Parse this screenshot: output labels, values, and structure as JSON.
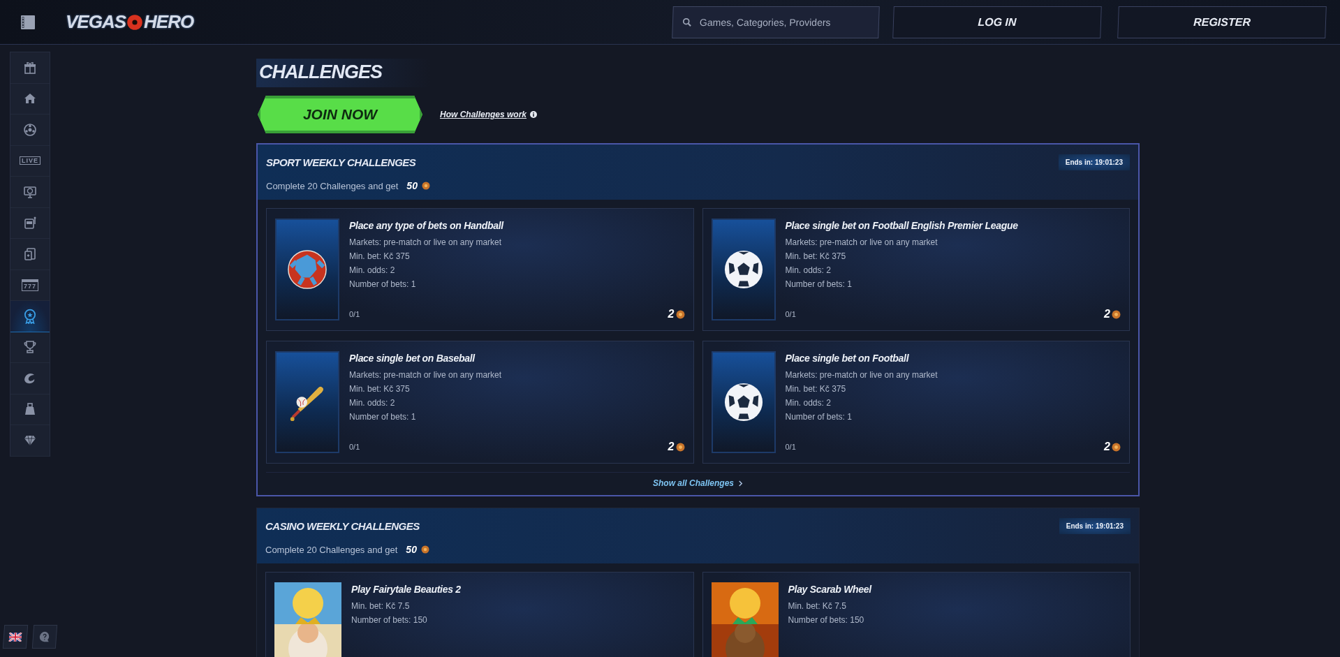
{
  "header": {
    "logo": {
      "left": "VEGAS",
      "right": "HERO"
    },
    "search": {
      "placeholder": "Games, Categories, Providers"
    },
    "buttons": [
      "LOG IN",
      "REGISTER"
    ]
  },
  "sidebar": {
    "items": [
      {
        "kind": "gift",
        "selected": false
      },
      {
        "kind": "home",
        "selected": false
      },
      {
        "kind": "ball",
        "selected": false
      },
      {
        "kind": "live",
        "label": "LIVE",
        "selected": false
      },
      {
        "kind": "screen",
        "selected": false
      },
      {
        "kind": "slot",
        "selected": false
      },
      {
        "kind": "cards",
        "selected": false
      },
      {
        "kind": "jackpot",
        "label": "777",
        "selected": false
      },
      {
        "kind": "medal",
        "selected": true
      },
      {
        "kind": "trophy",
        "selected": false
      },
      {
        "kind": "c",
        "selected": false
      },
      {
        "kind": "bag",
        "selected": false
      },
      {
        "kind": "diamond",
        "selected": false
      }
    ]
  },
  "page": {
    "title": "CHALLENGES",
    "join_button": "JOIN NOW",
    "help_link": "How Challenges work"
  },
  "sections": [
    {
      "title": "SPORT WEEKLY CHALLENGES",
      "ends": "Ends in: 19:01:23",
      "subtitle": "Complete 20 Challenges and get",
      "reward": "50",
      "show_all": "Show all Challenges",
      "challenges": [
        {
          "kind": "handball",
          "title": "Place any type of bets on Handball",
          "details": [
            "Markets:  pre-match or live on any market",
            "Min. bet: Kč 375",
            "Min. odds: 2",
            "Number of bets: 1"
          ],
          "progress": "0/1",
          "reward": "2"
        },
        {
          "kind": "football",
          "title": "Place single bet on Football English Premier League",
          "details": [
            "Markets:  pre-match or live on any market",
            "Min. bet: Kč 375",
            "Min. odds: 2",
            "Number of bets: 1"
          ],
          "progress": "0/1",
          "reward": "2"
        },
        {
          "kind": "baseball",
          "title": "Place single bet on Baseball",
          "details": [
            "Markets:  pre-match or live on any market",
            "Min. bet: Kč 375",
            "Min. odds: 2",
            "Number of bets: 1"
          ],
          "progress": "0/1",
          "reward": "2"
        },
        {
          "kind": "football",
          "title": "Place single bet on Football",
          "details": [
            "Markets:  pre-match or live on any market",
            "Min. bet: Kč 375",
            "Min. odds: 2",
            "Number of bets: 1"
          ],
          "progress": "0/1",
          "reward": "2"
        }
      ]
    },
    {
      "title": "CASINO WEEKLY CHALLENGES",
      "ends": "Ends in: 19:01:23",
      "subtitle": "Complete 20 Challenges and get",
      "reward": "50",
      "challenges": [
        {
          "kind": "picture",
          "title": "Play Fairytale Beauties 2",
          "details": [
            "Min. bet: Kč 7.5",
            "Number of bets: 150"
          ]
        },
        {
          "kind": "picture",
          "title": "Play Scarab Wheel",
          "details": [
            "Min. bet: Kč 7.5",
            "Number of bets: 150"
          ]
        }
      ]
    }
  ]
}
